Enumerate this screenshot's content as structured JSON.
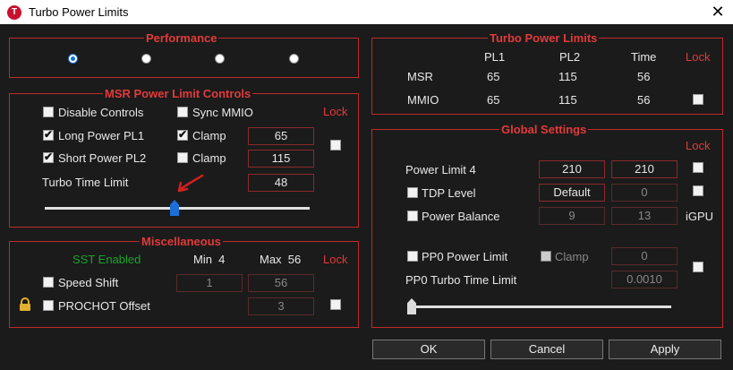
{
  "window": {
    "title": "Turbo Power Limits",
    "app_icon_letter": "T"
  },
  "performance": {
    "title": "Performance",
    "options": 4,
    "selected_index": 0
  },
  "msr": {
    "title": "MSR Power Limit Controls",
    "lock": "Lock",
    "disable_controls": "Disable Controls",
    "sync_mmio": "Sync MMIO",
    "long_power": "Long Power PL1",
    "short_power": "Short Power PL2",
    "clamp1": "Clamp",
    "clamp2": "Clamp",
    "pl1_value": "65",
    "pl2_value": "115",
    "turbo_time_label": "Turbo Time Limit",
    "turbo_time_value": "48"
  },
  "misc": {
    "title": "Miscellaneous",
    "sst": "SST Enabled",
    "min_label": "Min  4",
    "max_label": "Max  56",
    "lock": "Lock",
    "speed_shift": "Speed Shift",
    "speed_min": "1",
    "speed_max": "56",
    "prochot": "PROCHOT Offset",
    "prochot_value": "3"
  },
  "tpl": {
    "title": "Turbo Power Limits",
    "h_pl1": "PL1",
    "h_pl2": "PL2",
    "h_time": "Time",
    "lock": "Lock",
    "msr_label": "MSR",
    "msr_pl1": "65",
    "msr_pl2": "115",
    "msr_time": "56",
    "mmio_label": "MMIO",
    "mmio_pl1": "65",
    "mmio_pl2": "115",
    "mmio_time": "56"
  },
  "global": {
    "title": "Global Settings",
    "lock": "Lock",
    "pl4_label": "Power Limit 4",
    "pl4_a": "210",
    "pl4_b": "210",
    "tdp_label": "TDP Level",
    "tdp_a": "Default",
    "tdp_b": "0",
    "pb_label": "Power Balance",
    "pb_a": "9",
    "pb_b": "13",
    "igpu": "iGPU",
    "pp0_label": "PP0 Power Limit",
    "pp0_clamp": "Clamp",
    "pp0_value": "0",
    "pp0_turbo_label": "PP0 Turbo Time Limit",
    "pp0_turbo_value": "0.0010"
  },
  "buttons": {
    "ok": "OK",
    "cancel": "Cancel",
    "apply": "Apply"
  },
  "colors": {
    "accent_red": "#e23a3a",
    "border_red": "#c02a2a",
    "green": "#1aa32a",
    "blue": "#1a6fd8",
    "background": "#1b1b1b"
  }
}
